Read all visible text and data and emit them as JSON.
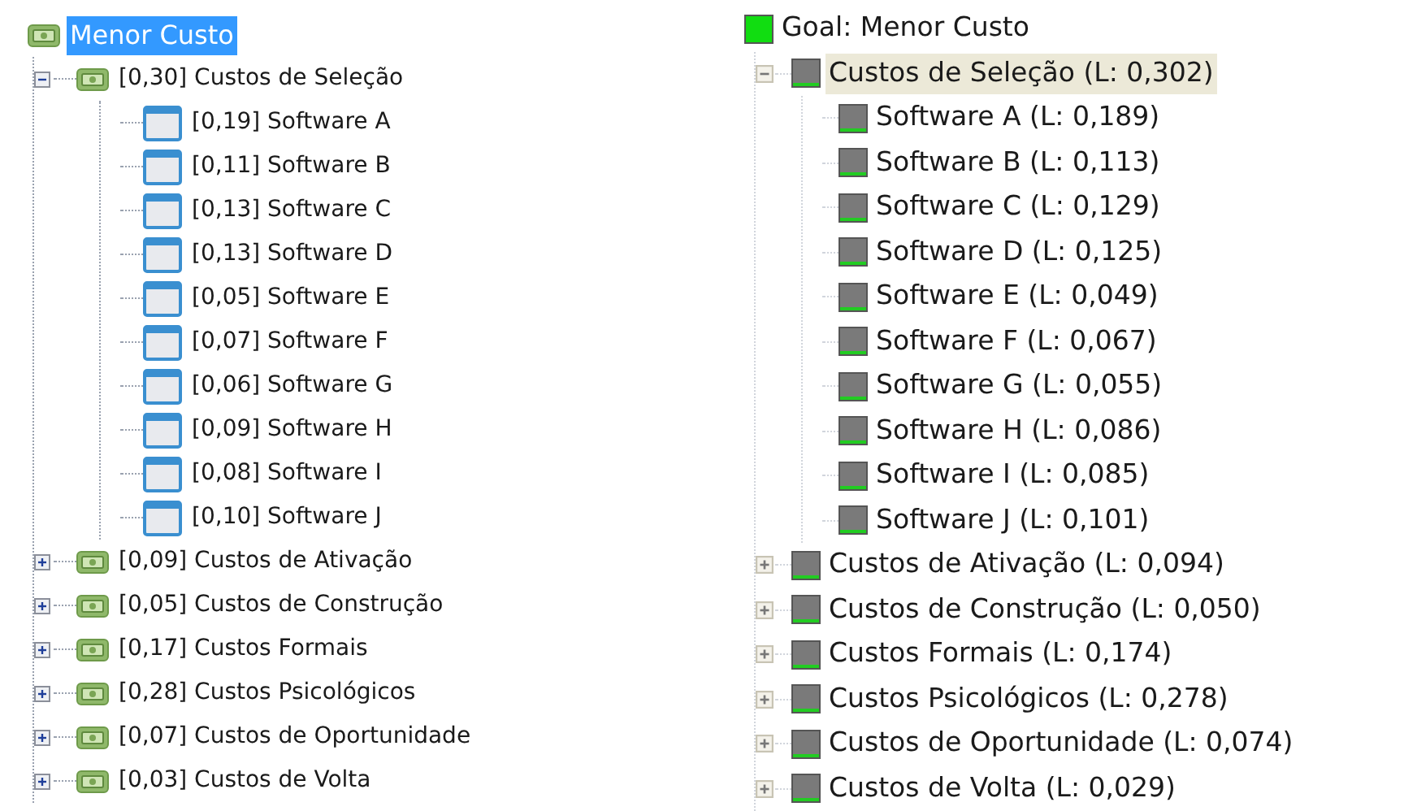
{
  "left_tree": {
    "label": "Menor Custo",
    "selected": true,
    "children": [
      {
        "label": "[0,30] Custos de Seleção",
        "selected": false,
        "expanded": true,
        "children": [
          {
            "label": "[0,19] Software A",
            "selected": false
          },
          {
            "label": "[0,11] Software B",
            "selected": false
          },
          {
            "label": "[0,13] Software C",
            "selected": false
          },
          {
            "label": "[0,13] Software D",
            "selected": false
          },
          {
            "label": "[0,05] Software E",
            "selected": false
          },
          {
            "label": "[0,07] Software F",
            "selected": false
          },
          {
            "label": "[0,06] Software G",
            "selected": false
          },
          {
            "label": "[0,09] Software H",
            "selected": false
          },
          {
            "label": "[0,08] Software I",
            "selected": false
          },
          {
            "label": "[0,10] Software J",
            "selected": false
          }
        ]
      },
      {
        "label": "[0,09] Custos de Ativação",
        "selected": false,
        "expanded": false
      },
      {
        "label": "[0,05] Custos de Construção",
        "selected": false,
        "expanded": false
      },
      {
        "label": "[0,17] Custos Formais",
        "selected": false,
        "expanded": false
      },
      {
        "label": "[0,28] Custos Psicológicos",
        "selected": false,
        "expanded": false
      },
      {
        "label": "[0,07] Custos de Oportunidade",
        "selected": false,
        "expanded": false
      },
      {
        "label": "[0,03] Custos de Volta",
        "selected": false,
        "expanded": false
      }
    ]
  },
  "right_tree": {
    "label": "Goal: Menor Custo",
    "selected": false,
    "children": [
      {
        "label": "Custos de Seleção (L: 0,302)",
        "selected": true,
        "expanded": true,
        "children": [
          {
            "label": "Software A (L: 0,189)",
            "selected": false
          },
          {
            "label": "Software B (L: 0,113)",
            "selected": false
          },
          {
            "label": "Software C (L: 0,129)",
            "selected": false
          },
          {
            "label": "Software D (L: 0,125)",
            "selected": false
          },
          {
            "label": "Software E (L: 0,049)",
            "selected": false
          },
          {
            "label": "Software F (L: 0,067)",
            "selected": false
          },
          {
            "label": "Software G (L: 0,055)",
            "selected": false
          },
          {
            "label": "Software H (L: 0,086)",
            "selected": false
          },
          {
            "label": "Software I (L: 0,085)",
            "selected": false
          },
          {
            "label": "Software J (L: 0,101)",
            "selected": false
          }
        ]
      },
      {
        "label": "Custos de Ativação (L: 0,094)",
        "selected": false,
        "expanded": false
      },
      {
        "label": "Custos de Construção (L: 0,050)",
        "selected": false,
        "expanded": false
      },
      {
        "label": "Custos Formais (L: 0,174)",
        "selected": false,
        "expanded": false
      },
      {
        "label": "Custos Psicológicos (L: 0,278)",
        "selected": false,
        "expanded": false
      },
      {
        "label": "Custos de Oportunidade (L: 0,074)",
        "selected": false,
        "expanded": false
      },
      {
        "label": "Custos de Volta (L: 0,029)",
        "selected": false,
        "expanded": false
      }
    ]
  }
}
